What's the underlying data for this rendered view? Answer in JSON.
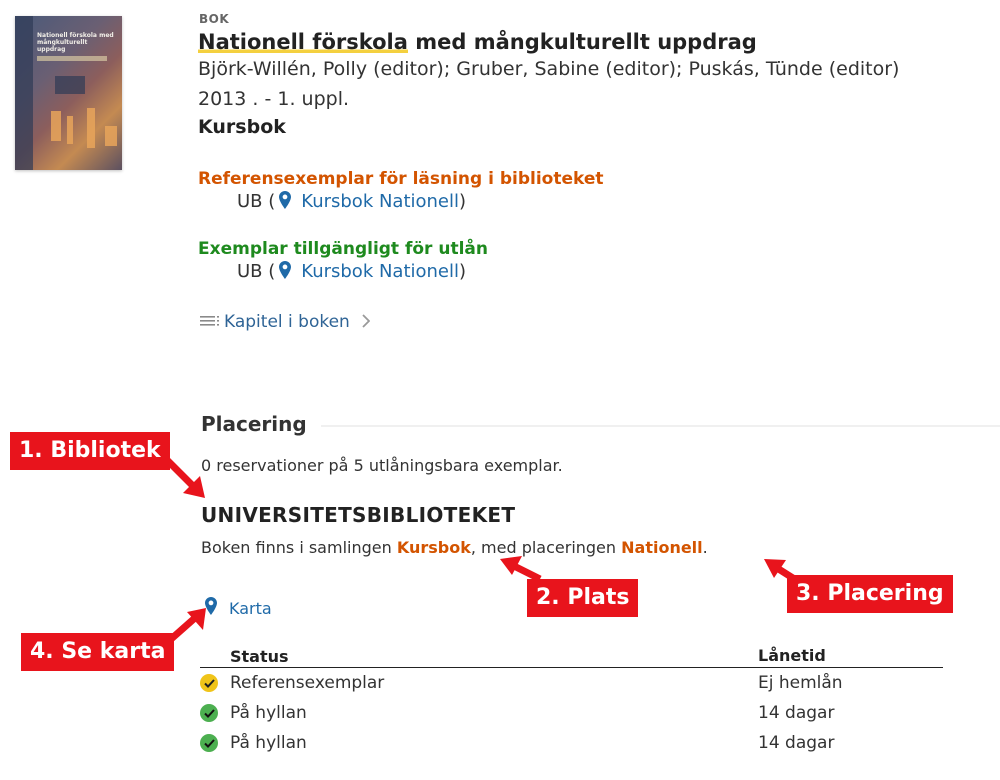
{
  "record": {
    "type_label": "BOK",
    "title_highlight": "Nationell förskola",
    "title_rest": " med mångkulturellt uppdrag",
    "authors": "Björk-Willén, Polly (editor); Gruber, Sabine (editor); Puskás, Tünde (editor)",
    "edition": "2013 . - 1. uppl.",
    "course_label": "Kursbok",
    "cover": {
      "title_text": "Nationell förskola med mångkulturellt uppdrag"
    }
  },
  "availability": {
    "reference": {
      "heading": "Referensexemplar för läsning i biblioteket",
      "library": "UB (",
      "location_link": "Kursbok Nationell",
      "close": ")"
    },
    "loan": {
      "heading": "Exemplar tillgängligt för utlån",
      "library": "UB (",
      "location_link": "Kursbok Nationell",
      "close": ")"
    }
  },
  "chapters_link": "Kapitel i boken",
  "placement": {
    "heading": "Placering",
    "reservations": "0 reservationer på 5 utlåningsbara exemplar.",
    "library_name": "UNIVERSITETSBIBLIOTEKET",
    "sentence_prefix": "Boken finns i samlingen ",
    "collection": "Kursbok",
    "sentence_mid": ", med placeringen ",
    "shelf": "Nationell",
    "sentence_end": ".",
    "map_link": "Karta"
  },
  "items_table": {
    "headers": {
      "status": "Status",
      "loan_time": "Lånetid"
    },
    "rows": [
      {
        "status": "Referensexemplar",
        "loan_time": "Ej hemlån",
        "icon": "check-yellow-icon"
      },
      {
        "status": "På hyllan",
        "loan_time": "14 dagar",
        "icon": "check-green-icon"
      },
      {
        "status": "På hyllan",
        "loan_time": "14 dagar",
        "icon": "check-green-icon"
      }
    ]
  },
  "callouts": {
    "c1": "1. Bibliotek",
    "c2": "2. Plats",
    "c3": "3. Placering",
    "c4": "4. Se karta"
  },
  "colors": {
    "orange": "#d35400",
    "green": "#1e8a1e",
    "link": "#1f6aa8",
    "callout_red": "#e8141c",
    "highlight": "#f4d03f"
  }
}
